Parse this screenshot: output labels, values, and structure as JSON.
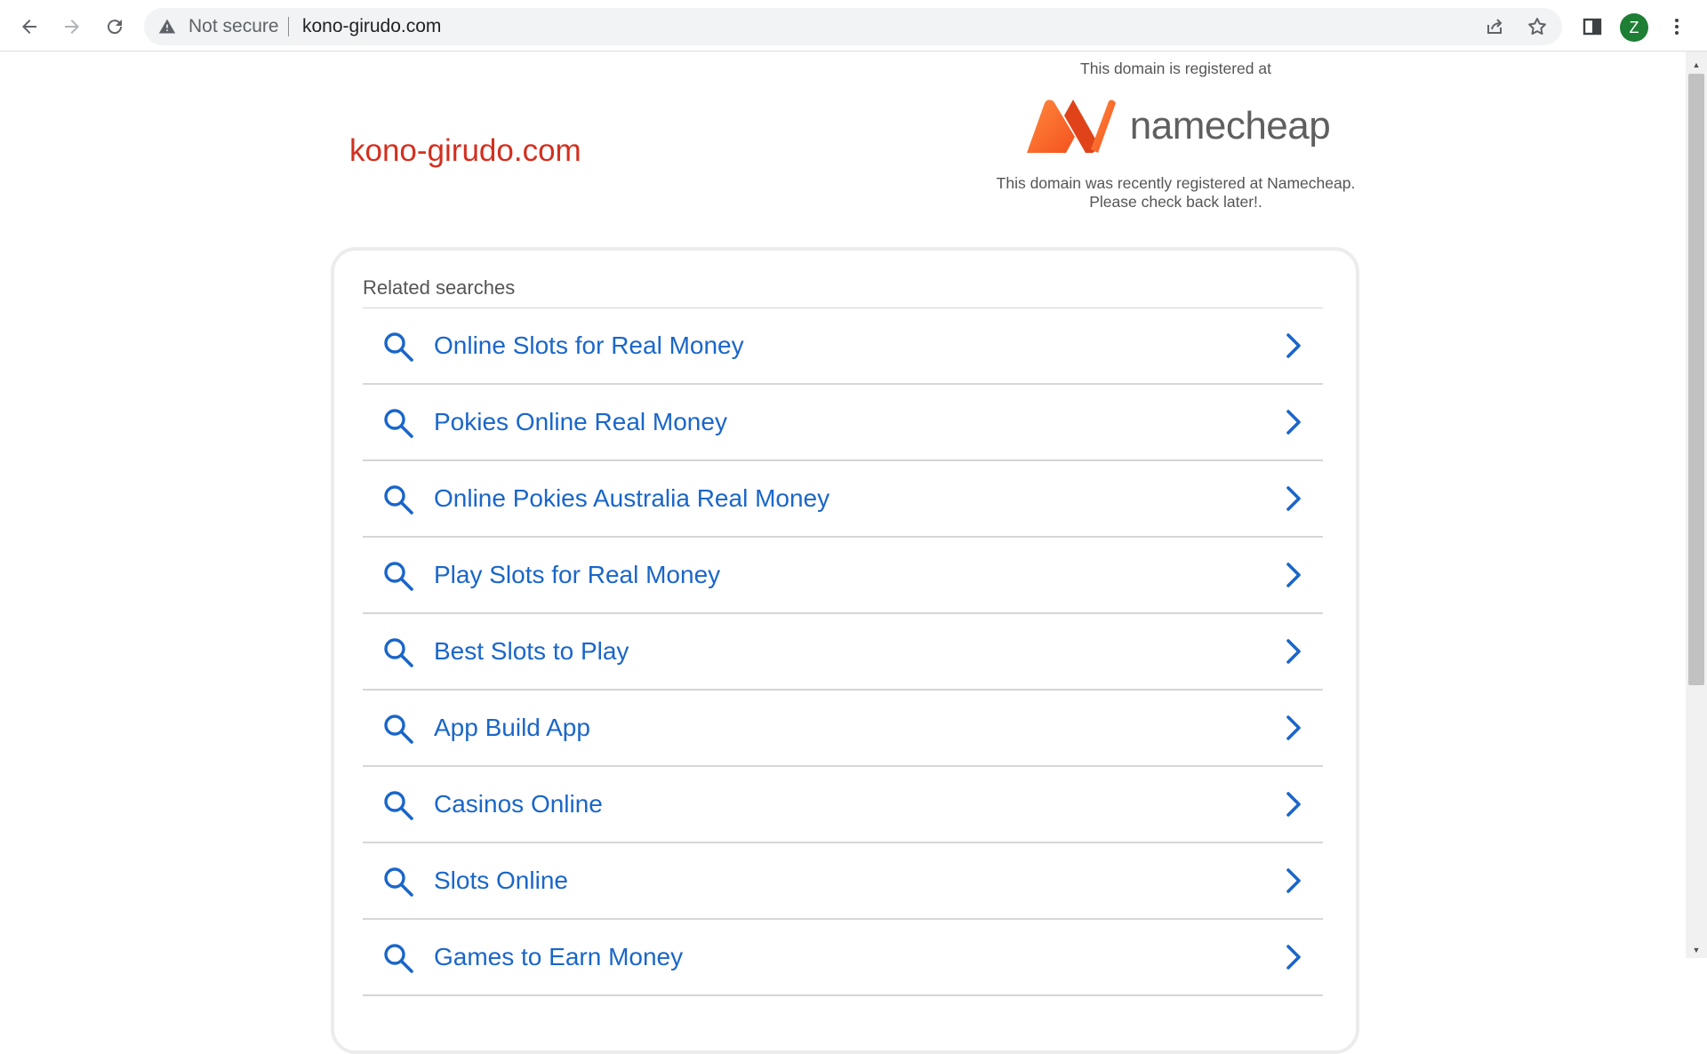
{
  "browser": {
    "security_label": "Not secure",
    "url": "kono-girudo.com",
    "profile_initial": "Z",
    "accent": "#1e7e34"
  },
  "page": {
    "domain_title": "kono-girudo.com",
    "registrar": {
      "registered_at": "This domain is registered at",
      "logo_text": "namecheap",
      "message_line1": "This domain was recently registered at Namecheap.",
      "message_line2": "Please check back later!."
    },
    "related": {
      "heading": "Related searches",
      "items": [
        {
          "label": "Online Slots for Real Money"
        },
        {
          "label": "Pokies Online Real Money"
        },
        {
          "label": "Online Pokies Australia Real Money"
        },
        {
          "label": "Play Slots for Real Money"
        },
        {
          "label": "Best Slots to Play"
        },
        {
          "label": "App Build App"
        },
        {
          "label": "Casinos Online"
        },
        {
          "label": "Slots Online"
        },
        {
          "label": "Games to Earn Money"
        }
      ]
    }
  },
  "colors": {
    "title_red": "#d32f1f",
    "link_blue": "#1a66c9",
    "logo_orange": "#f4511e"
  }
}
